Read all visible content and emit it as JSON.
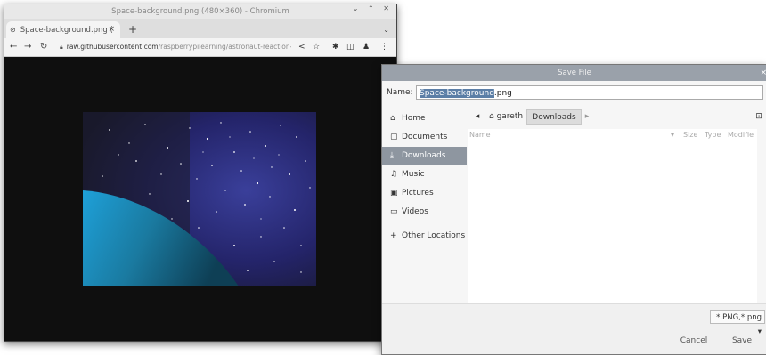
{
  "browser": {
    "window_title": "Space-background.png (480×360) - Chromium",
    "tab_title": "Space-background.png (",
    "new_tab_symbol": "+",
    "url_host": "raw.githubusercontent.com",
    "url_path": "/raspberrypilearning/astronaut-reaction-ti…",
    "window_controls": "⌄ ⌃ ✕",
    "icons": [
      "back-icon",
      "forward-icon",
      "reload-icon",
      "lock-icon",
      "share-icon",
      "star-icon",
      "extensions-icon",
      "sidepanel-icon",
      "profile-icon",
      "menu-icon"
    ]
  },
  "dialog": {
    "title": "Save File",
    "close": "×",
    "name_label": "Name:",
    "filename_selected": "Space-background",
    "filename_ext": ".png",
    "sidebar": [
      {
        "icon": "⌂",
        "label": "Home"
      },
      {
        "icon": "▢",
        "label": "Documents"
      },
      {
        "icon": "⤓",
        "label": "Downloads"
      },
      {
        "icon": "♫",
        "label": "Music"
      },
      {
        "icon": "▣",
        "label": "Pictures"
      },
      {
        "icon": "▭",
        "label": "Videos"
      },
      {
        "icon": "+",
        "label": "Other Locations"
      }
    ],
    "active_sidebar": "Downloads",
    "path_segments": [
      "gareth",
      "Downloads"
    ],
    "columns": [
      "Name",
      "Size",
      "Type",
      "Modifie"
    ],
    "filter": "*.PNG,*.png",
    "cancel": "Cancel",
    "save": "Save"
  }
}
